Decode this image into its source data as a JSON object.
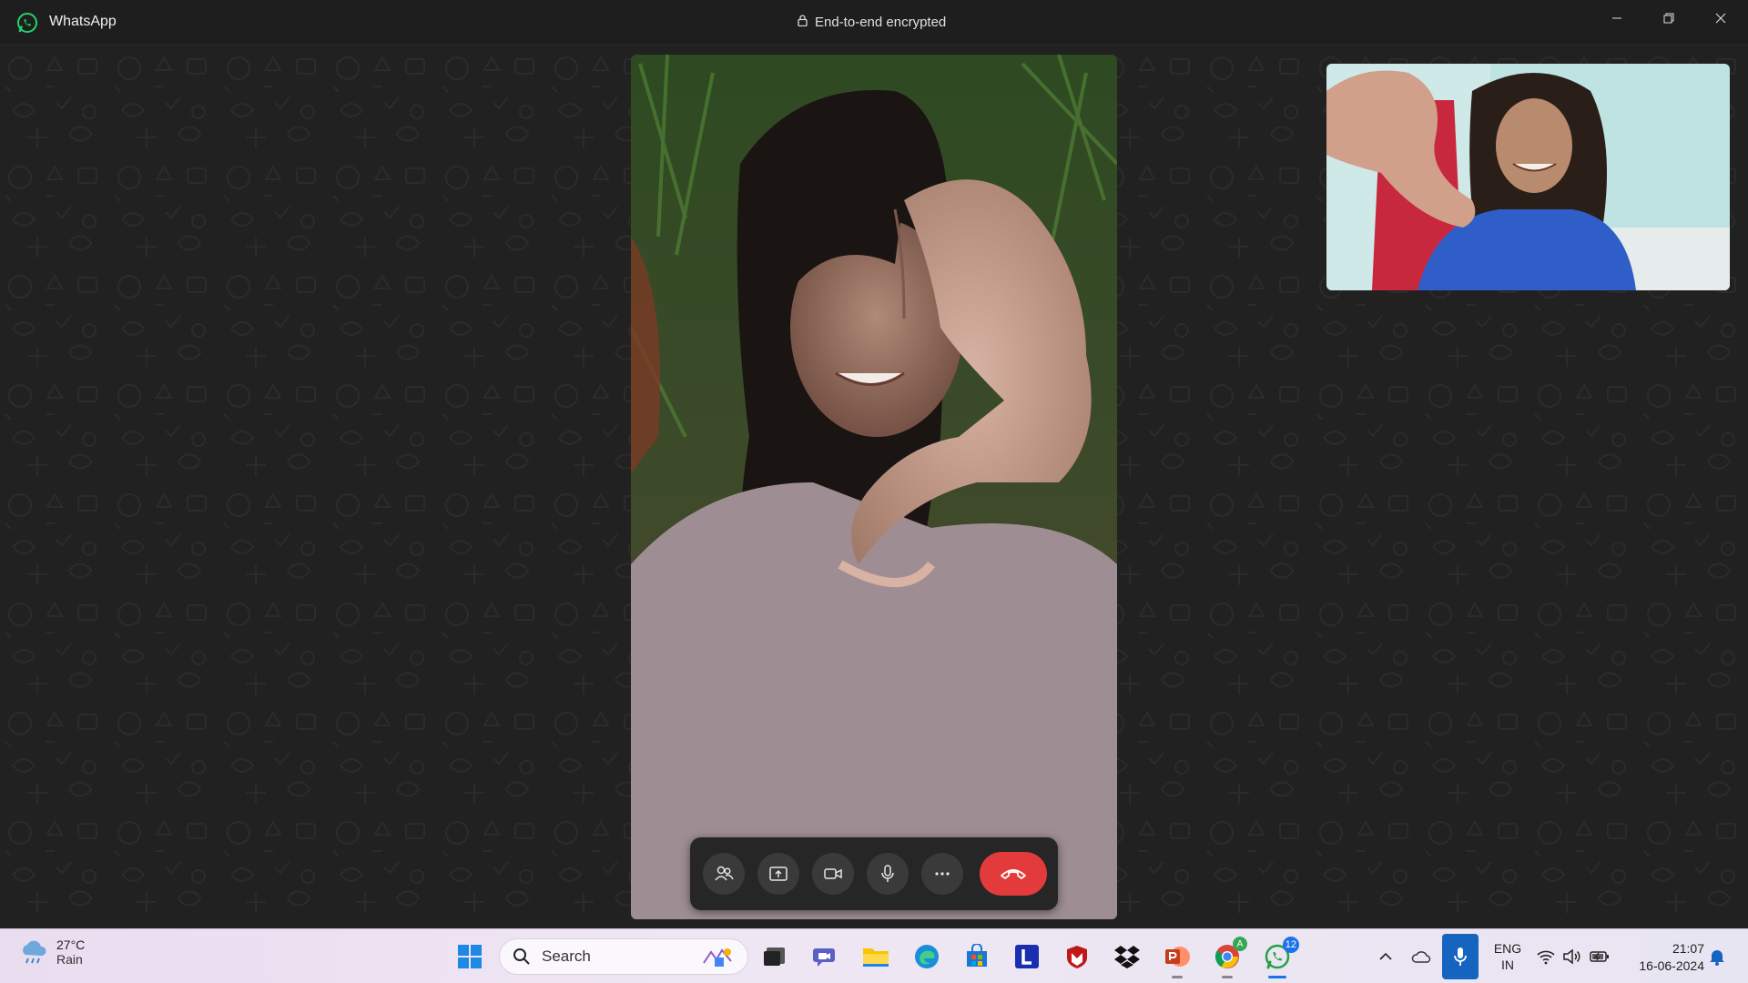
{
  "titlebar": {
    "app_name": "WhatsApp",
    "encryption_text": "End-to-end encrypted",
    "app_icon": "whatsapp-logo-icon",
    "window_controls": [
      "minimize-icon",
      "restore-icon",
      "close-icon"
    ]
  },
  "call": {
    "controls": [
      {
        "name": "participants-button",
        "icon": "people-icon"
      },
      {
        "name": "share-screen-button",
        "icon": "share-screen-icon"
      },
      {
        "name": "video-toggle-button",
        "icon": "video-camera-icon"
      },
      {
        "name": "mute-button",
        "icon": "microphone-icon"
      },
      {
        "name": "more-options-button",
        "icon": "ellipsis-icon"
      },
      {
        "name": "end-call-button",
        "icon": "hang-up-icon"
      }
    ],
    "end_call_color": "#e33b3b"
  },
  "taskbar": {
    "weather": {
      "temp": "27°C",
      "condition": "Rain"
    },
    "search_placeholder": "Search",
    "whatsapp_badge": "12",
    "chrome_badge": "A",
    "language": {
      "line1": "ENG",
      "line2": "IN"
    },
    "clock": {
      "time": "21:07",
      "date": "16-06-2024"
    },
    "apps": [
      "start-icon",
      "search-icon",
      "task-view-icon",
      "meet-icon",
      "file-explorer-icon",
      "edge-icon",
      "store-icon",
      "l-app-icon",
      "mcafee-icon",
      "dropbox-icon",
      "powerpoint-icon",
      "chrome-icon",
      "whatsapp-icon"
    ],
    "tray": [
      "show-hidden-icons-icon",
      "onedrive-icon",
      "microphone-in-use-icon",
      "wifi-icon",
      "volume-icon",
      "battery-icon",
      "notification-bell-icon"
    ]
  },
  "colors": {
    "background": "#212121",
    "titlebar": "#1e1e1e",
    "accent": "#1a73e8",
    "whatsapp_green": "#25d366"
  }
}
